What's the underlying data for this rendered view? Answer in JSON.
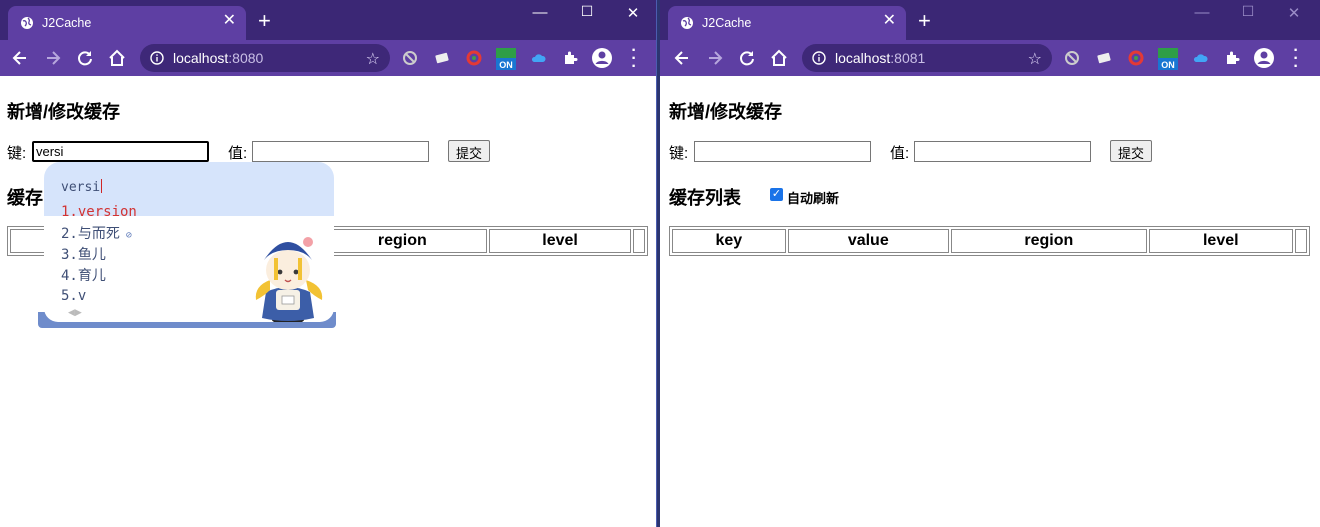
{
  "windows": [
    {
      "id": "left",
      "tab_title": "J2Cache",
      "url_host": "localhost",
      "url_port": ":8080",
      "form_title": "新增/修改缓存",
      "key_label": "键:",
      "key_value": "versi",
      "value_label": "值:",
      "value_value": "",
      "submit_label": "提交",
      "list_title": "缓存",
      "table_headers": [
        "region",
        "level"
      ]
    },
    {
      "id": "right",
      "tab_title": "J2Cache",
      "url_host": "localhost",
      "url_port": ":8081",
      "form_title": "新增/修改缓存",
      "key_label": "键:",
      "key_value": "",
      "value_label": "值:",
      "value_value": "",
      "submit_label": "提交",
      "list_title": "缓存列表",
      "auto_refresh_label": "自动刷新",
      "auto_refresh_checked": true,
      "table_headers": [
        "key",
        "value",
        "region",
        "level"
      ]
    }
  ],
  "ime": {
    "composition": "versi",
    "candidates": [
      "1.version",
      "2.与而死",
      "3.鱼儿",
      "4.育儿",
      "5.v"
    ],
    "selected_index": 0
  },
  "colors": {
    "titlebar": "#3b2775",
    "tab_active": "#5e3fa3",
    "omnibox": "#3e2878",
    "ime_highlight": "#d6e4fb",
    "ime_selected": "#d23333"
  },
  "icons": {
    "tab": "globe-icon",
    "nav": [
      "back-arrow-icon",
      "forward-arrow-icon",
      "reload-icon",
      "home-icon"
    ],
    "address": [
      "info-icon",
      "star-icon"
    ],
    "extensions": [
      "extension-grey-icon",
      "extension-window-icon",
      "extension-red-ring-icon",
      "extension-on-badge-icon",
      "cloud-icon",
      "puzzle-icon",
      "profile-icon",
      "menu-dots-icon"
    ]
  }
}
